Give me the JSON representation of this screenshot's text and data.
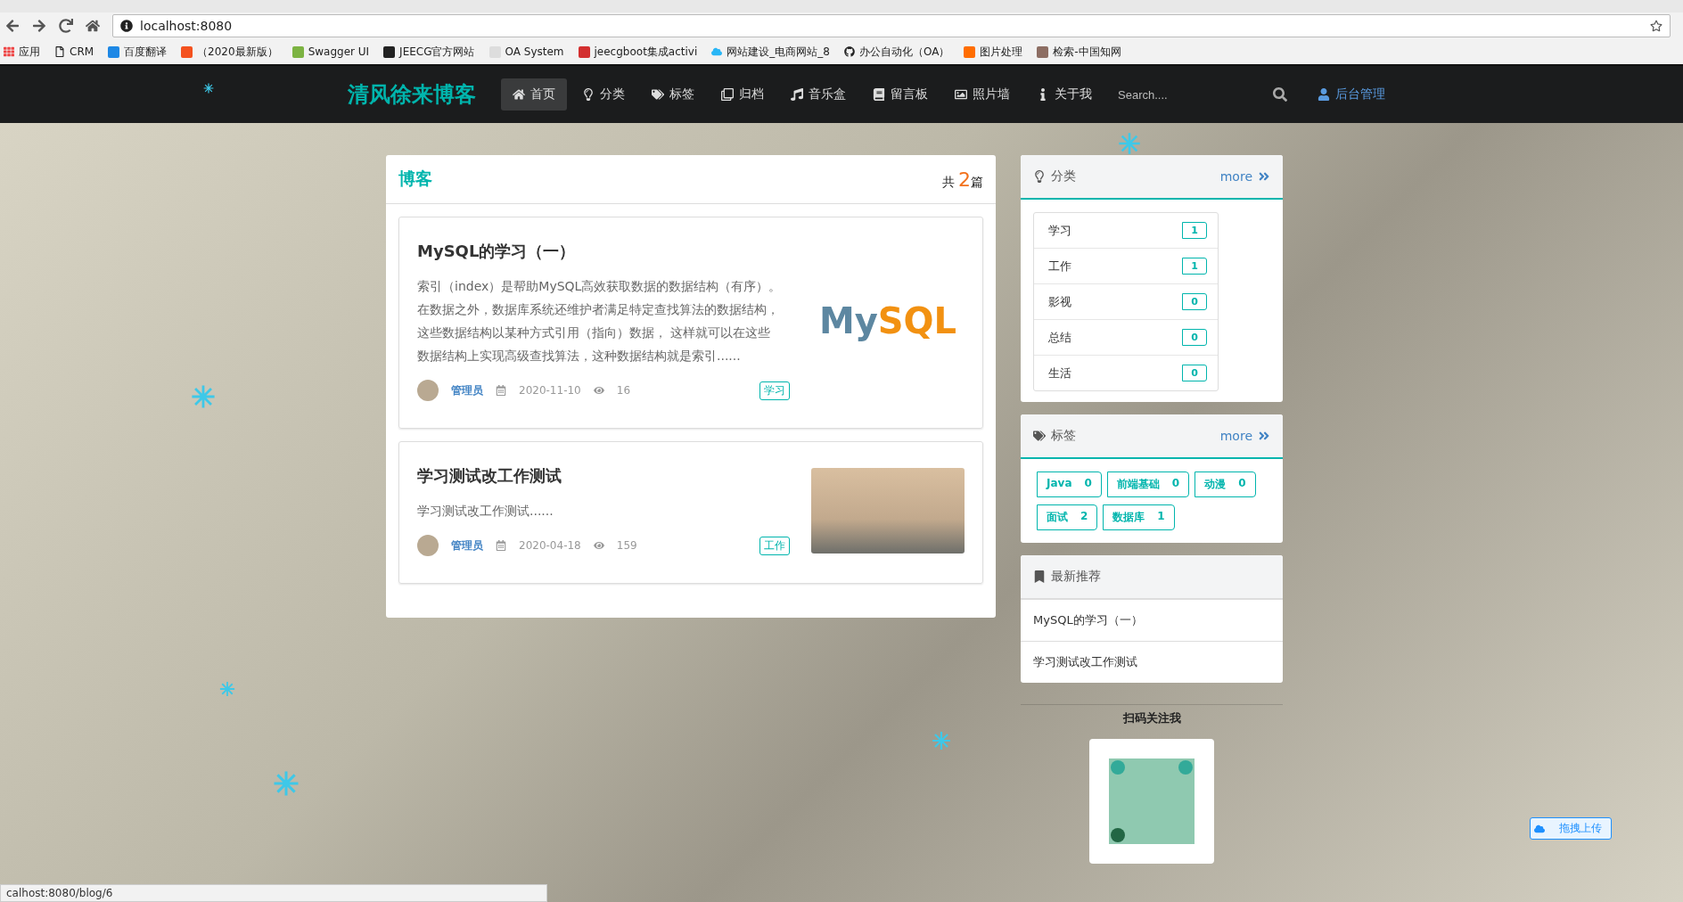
{
  "browser": {
    "address": "localhost:8080",
    "bookmarks": [
      "应用",
      "CRM",
      "百度翻译",
      "（2020最新版）",
      "Swagger UI",
      "JEECG官方网站",
      "OA System",
      "jeecgboot集成activi",
      "网站建设_电商网站_8",
      "办公自动化（OA）",
      "图片处理",
      "检索-中国知网"
    ]
  },
  "nav": {
    "brand": "清风徐来博客",
    "items": [
      {
        "label": "首页",
        "selected": true
      },
      {
        "label": "分类",
        "selected": false
      },
      {
        "label": "标签",
        "selected": false
      },
      {
        "label": "归档",
        "selected": false
      },
      {
        "label": "音乐盒",
        "selected": false
      },
      {
        "label": "留言板",
        "selected": false
      },
      {
        "label": "照片墙",
        "selected": false
      },
      {
        "label": "关于我",
        "selected": false
      }
    ],
    "search": {
      "placeholder": "Search...."
    },
    "admin": "后台管理"
  },
  "blog": {
    "title": "博客",
    "count_prefix": "共",
    "count": "2",
    "count_suffix": "篇",
    "posts": [
      {
        "title": "MySQL的学习（一）",
        "excerpt": "索引（index）是帮助MySQL高效获取数据的数据结构（有序）。在数据之外，数据库系统还维护者满足特定查找算法的数据结构，这些数据结构以某种方式引用（指向）数据， 这样就可以在这些数据结构上实现高级查找算法，这种数据结构就是索引......",
        "author": "管理员",
        "date": "2020-11-10",
        "views": "16",
        "tag": "学习",
        "image": {
          "kind": "logo",
          "text": "MySQL"
        }
      },
      {
        "title": "学习测试改工作测试",
        "excerpt": "学习测试改工作测试......",
        "author": "管理员",
        "date": "2020-04-18",
        "views": "159",
        "tag": "工作",
        "image": {
          "kind": "photo"
        }
      }
    ]
  },
  "categories": {
    "title": "分类",
    "more": "more",
    "items": [
      {
        "name": "学习",
        "count": "1"
      },
      {
        "name": "工作",
        "count": "1"
      },
      {
        "name": "影视",
        "count": "0"
      },
      {
        "name": "总结",
        "count": "0"
      },
      {
        "name": "生活",
        "count": "0"
      }
    ]
  },
  "tags": {
    "title": "标签",
    "more": "more",
    "items": [
      {
        "name": "Java",
        "count": "0"
      },
      {
        "name": "前端基础",
        "count": "0"
      },
      {
        "name": "动漫",
        "count": "0"
      },
      {
        "name": "面试",
        "count": "2"
      },
      {
        "name": "数据库",
        "count": "1"
      }
    ]
  },
  "recommend": {
    "title": "最新推荐",
    "items": [
      "MySQL的学习（一）",
      "学习测试改工作测试"
    ]
  },
  "qr": {
    "title": "扫码关注我"
  },
  "upload": {
    "label": "拖拽上传"
  },
  "status": "calhost:8080/blog/6"
}
